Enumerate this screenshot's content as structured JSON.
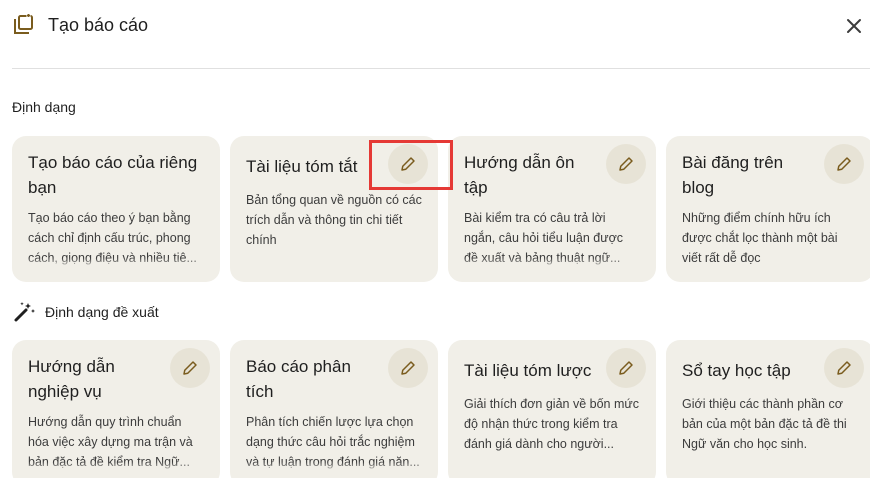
{
  "header": {
    "title": "Tạo báo cáo",
    "icon": "report-add-icon",
    "close_icon": "close-icon"
  },
  "formats_label": "Định dạng",
  "format_cards": [
    {
      "title": "Tạo báo cáo của riêng bạn",
      "description": "Tạo báo cáo theo ý bạn bằng cách chỉ định cấu trúc, phong cách, giọng điệu và nhiều tiê...",
      "has_edit": false
    },
    {
      "title": "Tài liệu tóm tắt",
      "description": "Bản tổng quan về nguồn có các trích dẫn và thông tin chi tiết chính",
      "has_edit": true
    },
    {
      "title": "Hướng dẫn ôn tập",
      "description": "Bài kiểm tra có câu trả lời ngắn, câu hỏi tiểu luận được đề xuất và bảng thuật ngữ...",
      "has_edit": true
    },
    {
      "title": "Bài đăng trên blog",
      "description": "Những điểm chính hữu ích được chắt lọc thành một bài viết rất dễ đọc",
      "has_edit": true
    }
  ],
  "suggested_label": "Định dạng đề xuất",
  "suggested_icon": "magic-wand-icon",
  "suggested_cards": [
    {
      "title": "Hướng dẫn nghiệp vụ",
      "description": "Hướng dẫn quy trình chuẩn hóa việc xây dựng ma trận và bản đặc tả đề kiểm tra Ngữ..."
    },
    {
      "title": "Báo cáo phân tích",
      "description": "Phân tích chiến lược lựa chọn dạng thức câu hỏi trắc nghiệm và tự luận trong đánh giá năn..."
    },
    {
      "title": "Tài liệu tóm lược",
      "description": "Giải thích đơn giản về bốn mức độ nhận thức trong kiểm tra đánh giá dành cho người..."
    },
    {
      "title": "Sổ tay học tập",
      "description": "Giới thiệu các thành phần cơ bản của một bản đặc tả đề thi Ngữ văn cho học sinh."
    }
  ],
  "colors": {
    "card_bg": "#f1efe8",
    "edit_bg": "#e7e3d6",
    "accent_icon": "#7a5c1e",
    "highlight": "#e53935"
  }
}
